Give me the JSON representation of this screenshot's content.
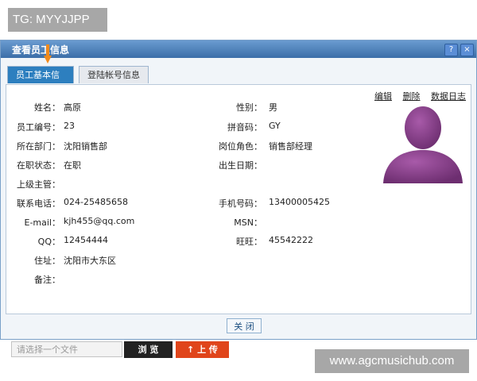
{
  "watermark_top": "TG: MYYJJPP",
  "watermark_bottom": "www.agcmusichub.com",
  "dialog": {
    "title": "查看员工信息",
    "help_icon_label": "?",
    "close_icon_label": "×"
  },
  "tabs": [
    {
      "label": "员工基本信息",
      "active": true
    },
    {
      "label": "登陆帐号信息",
      "active": false
    }
  ],
  "actions": {
    "edit": "编辑",
    "delete": "删除",
    "log": "数据日志"
  },
  "left_fields": [
    {
      "label": "姓名：",
      "value": "高原"
    },
    {
      "label": "员工编号：",
      "value": "23"
    },
    {
      "label": "所在部门：",
      "value": "沈阳销售部"
    },
    {
      "label": "在职状态：",
      "value": "在职"
    },
    {
      "label": "上级主管：",
      "value": ""
    },
    {
      "label": "联系电话：",
      "value": "024-25485658"
    },
    {
      "label": "E-mail：",
      "value": "kjh455@qq.com"
    },
    {
      "label": "QQ：",
      "value": "12454444"
    },
    {
      "label": "住址：",
      "value": "沈阳市大东区"
    },
    {
      "label": "备注：",
      "value": ""
    }
  ],
  "right_fields": [
    {
      "label": "性别：",
      "value": "男"
    },
    {
      "label": "拼音码：",
      "value": "GY"
    },
    {
      "label": "岗位角色：",
      "value": "销售部经理"
    },
    {
      "label": "出生日期：",
      "value": ""
    },
    {
      "label": "手机号码：",
      "value": "13400005425"
    },
    {
      "label": "MSN：",
      "value": ""
    },
    {
      "label": "旺旺：",
      "value": "45542222"
    }
  ],
  "upload": {
    "placeholder": "请选择一个文件",
    "browse_label": "浏 览",
    "upload_label": "↑ 上 传"
  },
  "close_button_label": "关 闭",
  "colors": {
    "title_bar": "#3b6ea8",
    "tab_active": "#2d7fbf",
    "avatar": "#8a3f8c",
    "upload_button": "#e0451b"
  }
}
